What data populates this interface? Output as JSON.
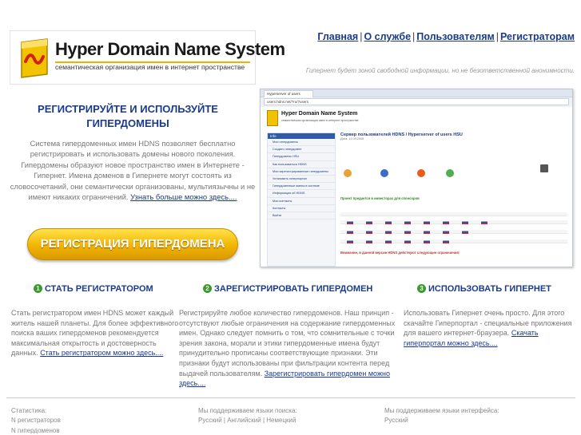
{
  "header": {
    "logo": {
      "title": "Hyper Domain Name System",
      "subtitle": "семантическая организация имен в интернет пространстве"
    },
    "nav": [
      {
        "label": "Главная"
      },
      {
        "label": "О службе"
      },
      {
        "label": "Пользователям"
      },
      {
        "label": "Регистраторам"
      }
    ],
    "nav_separator": "|",
    "tagline": "Гипернет будет зоной свободной информации, но не безответственной анонимности."
  },
  "promo": {
    "title": "РЕГИСТРИРУЙТЕ И ИСПОЛЬЗУЙТЕ ГИПЕРДОМЕНЫ",
    "text": "Система гипердоменных имен HDNS позволяет бесплатно регистрировать и использовать домены нового поколения.  Гипердомены образуют новое пространство имен в Интернете - Гипернет. Имена  доменов в Гипернете могут состоять из словосочетаний, они семантически организованы, мультиязычны и не имеют никаких ограничений.",
    "link": "Узнать больше можно здесь....",
    "button": "РЕГИСТРАЦИЯ ГИПЕРДОМЕНА"
  },
  "screenshot": {
    "tab_title": "Hyperserver of users",
    "url": "users.hdns.net/?ru/?users",
    "logo_title": "Hyper Domain Name System",
    "logo_sub": "семантическая организация имен в интернет пространстве",
    "side_header": "Info",
    "side_items": [
      "Мои гипердомены",
      "Создать гипердомен",
      "Гипердомены HSU",
      "Как пользоваться HDNS",
      "Мои зарегистрированные гипердомены",
      "Установить гиперпортал",
      "Гипердоменные имена в системе",
      "Информация об HDNS",
      "Мои контакты",
      "Контакты",
      "Выйти"
    ],
    "main_title": "Сервер пользователей HDNS / Hyperserver of users HSU",
    "main_date": "Дата: 11.09.2008",
    "green_text": "Проект предается в инвесторах для спонсоров",
    "red_text": "Внимание, в данной версии HDNS действуют следующие ограничения:"
  },
  "features": [
    {
      "number": "1",
      "title": "СТАТЬ РЕГИСТРАТОРОМ",
      "text": "Стать регистратором имен HDNS может каждый житель нашей планеты. Для более эффективного поиска ваших гипердоменов рекомендуется максимальная открытость и достоверность данных.",
      "link": "Стать регистратором можно здесь...."
    },
    {
      "number": "2",
      "title": "ЗАРЕГИСТРИРОВАТЬ ГИПЕРДОМЕН",
      "text": "Регистрируйте любое количество гипердоменов. Наш принцип - отсутствуют любые ограничения на содержание гипердоменных имен. Однако следует помнить о том, что сомнительные с точки зрения закона, морали и этики гипердоменные имена будут принудительно прописаны соответствующие признаки. Эти признаки будут использованы при фильтрации контента перед выдачей пользователям.",
      "link": "Зарегистрировать гипердомен можно здесь...."
    },
    {
      "number": "3",
      "title": "ИСПОЛЬЗОВАТЬ ГИПЕРНЕТ",
      "text": "Использовать Гипернет очень просто. Для этого скачайте Гиперпортал - специальные приложения для вашего интернет-браузера.",
      "link": "Скачать гиперпортал можно здесь...."
    }
  ],
  "footer": {
    "stats_title": "Статистика:",
    "stats_registrars": "N регистраторов",
    "stats_hyperdomains": "N гипердоменов",
    "search_title": "Мы поддерживаем языки поиска:",
    "search_langs": "Русский | Английский | Немецкий",
    "ui_title": "Мы поддерживаем языки интерфейса:",
    "ui_langs": "Русский"
  }
}
